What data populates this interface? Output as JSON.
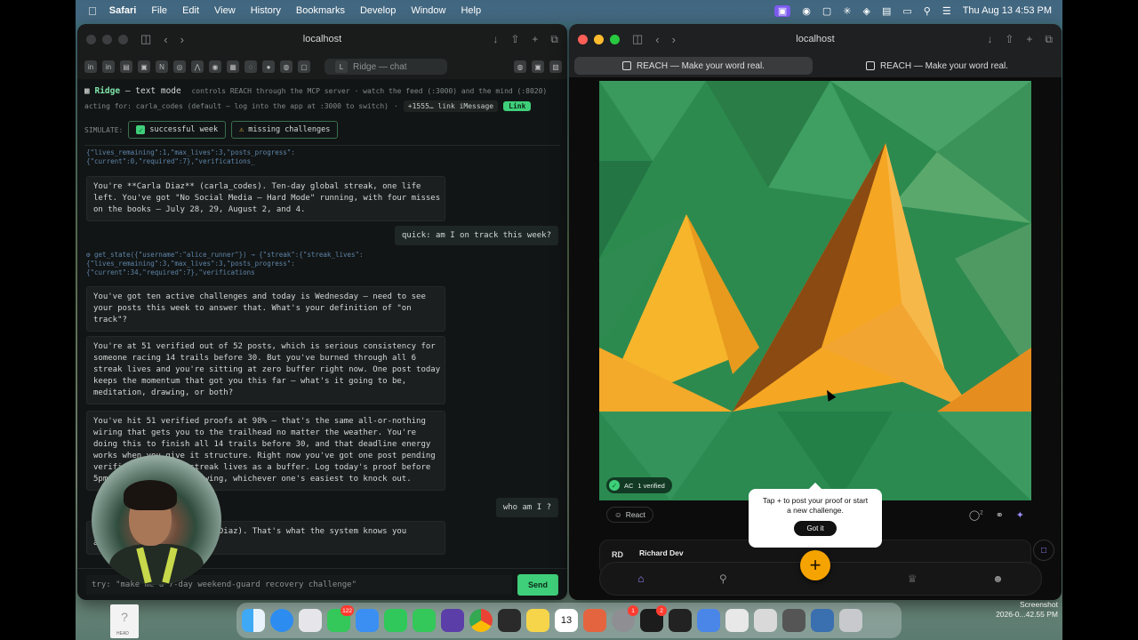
{
  "menubar": {
    "app": "Safari",
    "menus": [
      "File",
      "Edit",
      "View",
      "History",
      "Bookmarks",
      "Develop",
      "Window",
      "Help"
    ],
    "clock": "Thu Aug 13  4:53 PM"
  },
  "left_window": {
    "url": "localhost",
    "tab_label": "Ridge — chat",
    "header": {
      "icon": "robot-emoji",
      "title": "Ridge",
      "title_suffix": "— text mode",
      "title_note": "controls REACH through the MCP server · watch the feed (:3000) and the mind (:8020)",
      "acting_for": "acting for: carla_codes (default — log into the app at :3000 to switch)",
      "separator": "·",
      "imessage_chip": "+1555… link iMessage",
      "link_label": "Link"
    },
    "simulate": {
      "label": "SIMULATE:",
      "buttons": [
        {
          "label": "successful week",
          "icon": "check-icon"
        },
        {
          "label": "missing challenges",
          "icon": "warning-icon"
        }
      ]
    },
    "messages": {
      "tool_1": "{\"lives_remaining\":1,\"max_lives\":3,\"posts_progress\":\n{\"current\":0,\"required\":7},\"verifications_",
      "bubble_1": "You're **Carla Diaz** (carla_codes). Ten-day global streak, one life\nleft. You've got \"No Social Media — Hard Mode\" running, with four misses\non the books — July 28, 29, August 2, and 4.",
      "user_1": "quick: am I on track this week?",
      "tool_2": "⚙ get_state({\"username\":\"alice_runner\"}) → {\"streak\":{\"streak_lives\":\n{\"lives_remaining\":3,\"max_lives\":3,\"posts_progress\":\n{\"current\":34,\"required\":7},\"verifications",
      "bubble_2": "You've got ten active challenges and today is Wednesday — need to see\nyour posts this week to answer that. What's your definition of \"on\ntrack\"?",
      "bubble_3": "You're at 51 verified out of 52 posts, which is serious consistency for\nsomeone racing 14 trails before 30. But you've burned through all 6\nstreak lives and you're sitting at zero buffer right now. One post today\nkeeps the momentum that got you this far — what's it going to be,\nmeditation, drawing, or both?",
      "bubble_4": "You've hit 51 verified proofs at 98% — that's the same all-or-nothing\nwiring that gets you to the trailhead no matter the weather. You're\ndoing this to finish all 14 trails before 30, and that deadline energy\nworks when you give it structure. Right now you've got one post pending\nverification and no streak lives as a buffer. Log today's proof before\n5pm — meditation or drawing, whichever one's easiest to knock out.",
      "user_2": "who am I ?",
      "bubble_5": "You're carla_codes (Carla Diaz). That's what the system knows you\nas."
    },
    "input": {
      "placeholder": "try: \"make me a 7-day weekend-guard recovery challenge\"",
      "send_label": "Send"
    }
  },
  "right_window": {
    "url": "localhost",
    "tabs": [
      "REACH — Make your word real.",
      "REACH — Make your word real."
    ],
    "post": {
      "avatar_initials": "AC",
      "verified_label": "1 verified",
      "react_label": "React",
      "comment_count": "2"
    },
    "tooltip": {
      "text": "Tap + to post your proof or start a new challenge.",
      "button": "Got it"
    },
    "next_post": {
      "avatar_initials": "RD",
      "name": "Richard Dev"
    },
    "colors": {
      "accent_green": "#3fcf7a",
      "brand_orange": "#f5a300",
      "accent_purple": "#9b8cff"
    }
  },
  "dock": {
    "badges": {
      "messages": "122",
      "settings": "1",
      "terminal": "2"
    },
    "calendar_day": "13"
  },
  "desktop": {
    "screenshot_label": "Screenshot",
    "screenshot_time": "2026-0...42.55 PM",
    "file_label": "HEAD"
  }
}
